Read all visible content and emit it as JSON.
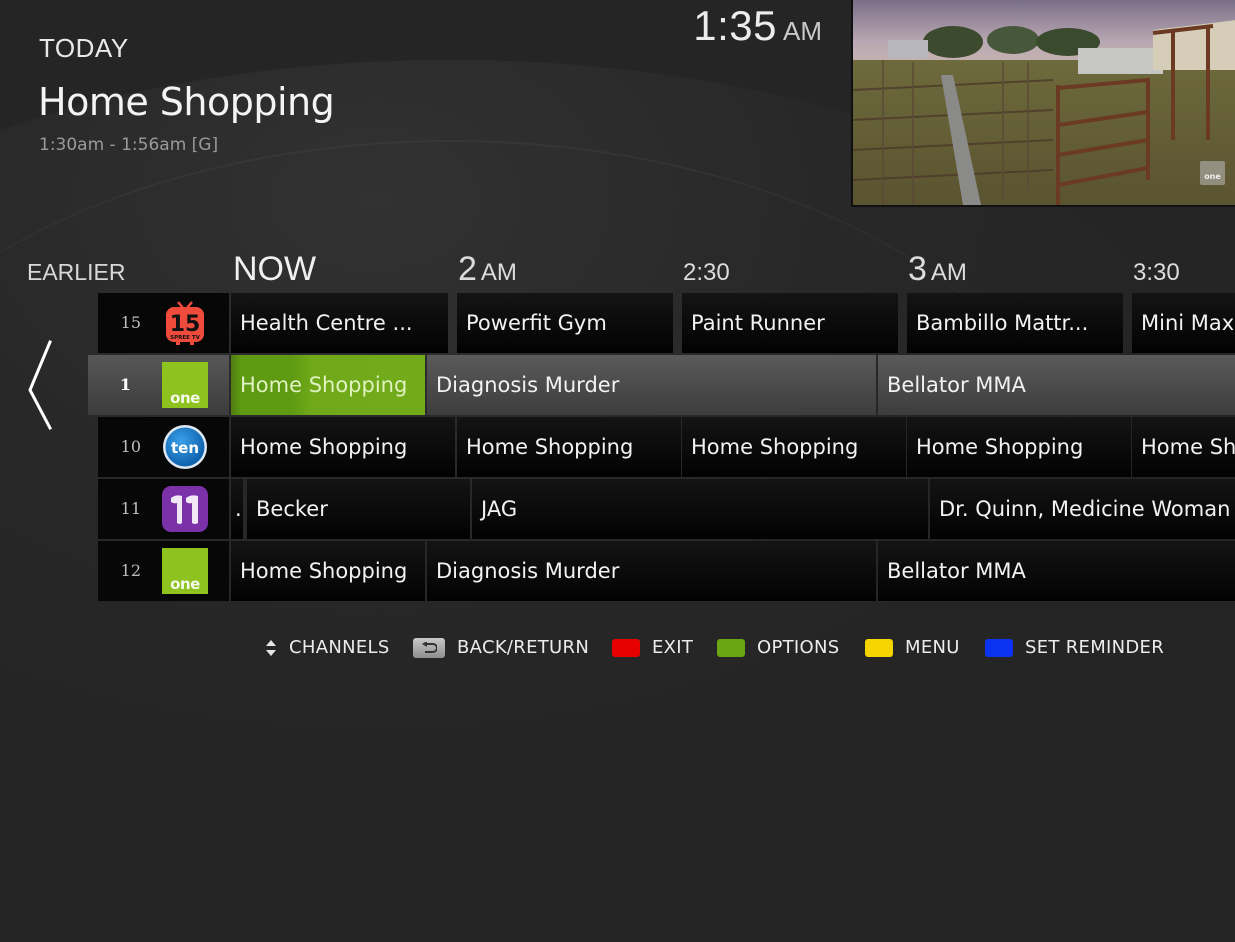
{
  "header": {
    "day_label": "TODAY",
    "program_title": "Home Shopping",
    "program_time": "1:30am - 1:56am [G]",
    "clock_time": "1:35",
    "clock_ampm": "AM"
  },
  "preview": {
    "network_bug": "one"
  },
  "timeline": {
    "earlier_label": "EARLIER",
    "now_label": "NOW",
    "ticks": [
      {
        "main": "2",
        "suffix": "AM",
        "kind": "hour"
      },
      {
        "main": "2:30",
        "suffix": "",
        "kind": "half"
      },
      {
        "main": "3",
        "suffix": "AM",
        "kind": "hour"
      },
      {
        "main": "3:30",
        "suffix": "",
        "kind": "half"
      }
    ]
  },
  "nav": {
    "prev_icon": "chevron-left-icon"
  },
  "guide": {
    "rows": [
      {
        "channel_number": "15",
        "channel_logo": "spree-tv-logo",
        "selected": false,
        "programs": [
          {
            "title": "Health Centre ..."
          },
          {
            "title": "Powerfit Gym"
          },
          {
            "title": "Paint Runner"
          },
          {
            "title": "Bambillo Mattr..."
          },
          {
            "title": "Mini Max"
          }
        ]
      },
      {
        "channel_number": "1",
        "channel_logo": "one-logo",
        "selected": true,
        "programs": [
          {
            "title": "Home Shopping",
            "focused": true
          },
          {
            "title": "Diagnosis Murder"
          },
          {
            "title": "Bellator MMA"
          }
        ]
      },
      {
        "channel_number": "10",
        "channel_logo": "ten-logo",
        "selected": false,
        "programs": [
          {
            "title": "Home Shopping"
          },
          {
            "title": "Home Shopping"
          },
          {
            "title": "Home Shopping"
          },
          {
            "title": "Home Shopping"
          },
          {
            "title": "Home Shopping"
          }
        ]
      },
      {
        "channel_number": "11",
        "channel_logo": "eleven-logo",
        "selected": false,
        "programs": [
          {
            "title": "."
          },
          {
            "title": "Becker"
          },
          {
            "title": "JAG"
          },
          {
            "title": "Dr. Quinn, Medicine Woman"
          }
        ]
      },
      {
        "channel_number": "12",
        "channel_logo": "one-logo",
        "selected": false,
        "programs": [
          {
            "title": "Home Shopping"
          },
          {
            "title": "Diagnosis Murder"
          },
          {
            "title": "Bellator MMA"
          }
        ]
      }
    ]
  },
  "footer": {
    "channels_label": "CHANNELS",
    "back_label": "BACK/RETURN",
    "exit_label": "EXIT",
    "options_label": "OPTIONS",
    "menu_label": "MENU",
    "reminder_label": "SET REMINDER",
    "colors": {
      "red": "#e60000",
      "green": "#6aa514",
      "yellow": "#f5d400",
      "blue": "#0a32f0"
    }
  },
  "colors": {
    "focus_green": "#6fa819",
    "background": "#252525"
  }
}
